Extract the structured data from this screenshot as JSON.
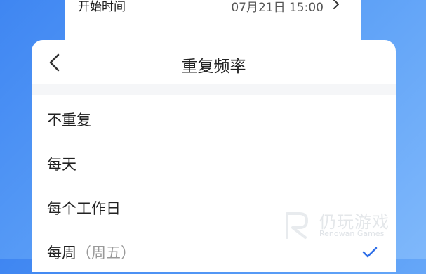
{
  "start_time": {
    "label": "开始时间",
    "value": "07月21日 15:00"
  },
  "sheet": {
    "title": "重复频率",
    "options": [
      {
        "label": "不重复",
        "sub": ""
      },
      {
        "label": "每天",
        "sub": ""
      },
      {
        "label": "每个工作日",
        "sub": ""
      },
      {
        "label": "每周",
        "sub": "（周五）",
        "selected": true
      }
    ]
  },
  "watermark": {
    "cn": "仍玩游戏",
    "en": "Renowan Games"
  },
  "colors": {
    "accent": "#2f6fe8",
    "background": "#4a8ff3"
  }
}
